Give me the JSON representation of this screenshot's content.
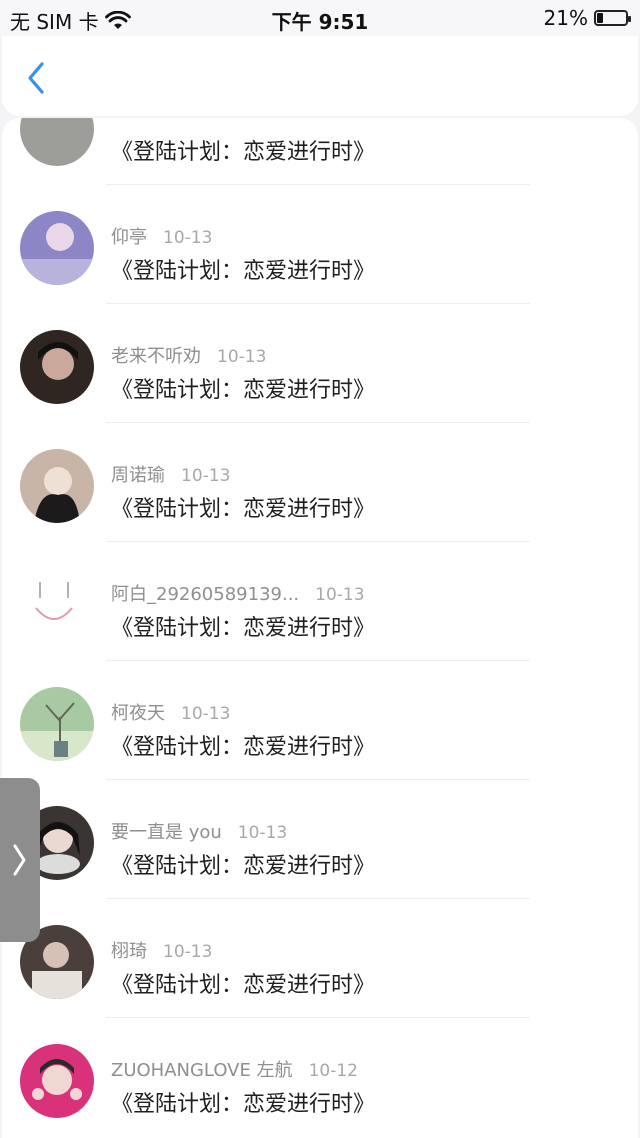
{
  "status_bar": {
    "carrier": "无 SIM 卡",
    "time": "下午 9:51",
    "battery_percent": "21%",
    "battery_level": 0.21
  },
  "nav": {
    "back_icon": "chevron-left-icon"
  },
  "side_tab": {
    "icon": "chevron-right-icon"
  },
  "items": [
    {
      "name": "",
      "date": "",
      "message": "《登陆计划：恋爱进行时》",
      "avatar_color": "#9d9d9a"
    },
    {
      "name": "仰亭",
      "date": "10-13",
      "message": "《登陆计划：恋爱进行时》",
      "avatar_color": "#8c86c6"
    },
    {
      "name": "老来不听劝",
      "date": "10-13",
      "message": "《登陆计划：恋爱进行时》",
      "avatar_color": "#2f2521"
    },
    {
      "name": "周诺瑜",
      "date": "10-13",
      "message": "《登陆计划：恋爱进行时》",
      "avatar_color": "#c9b5a8"
    },
    {
      "name": "阿白_29260589139...",
      "date": "10-13",
      "message": "《登陆计划：恋爱进行时》",
      "avatar_color": "#ffffff"
    },
    {
      "name": "柯夜天",
      "date": "10-13",
      "message": "《登陆计划：恋爱进行时》",
      "avatar_color": "#a9c9a3"
    },
    {
      "name": "要一直是 you",
      "date": "10-13",
      "message": "《登陆计划：恋爱进行时》",
      "avatar_color": "#3a3433"
    },
    {
      "name": "栩琦",
      "date": "10-13",
      "message": "《登陆计划：恋爱进行时》",
      "avatar_color": "#4a3f3a"
    },
    {
      "name": "ZUOHANGLOVE 左航",
      "date": "10-12",
      "message": "《登陆计划：恋爱进行时》",
      "avatar_color": "#d9327a"
    }
  ]
}
